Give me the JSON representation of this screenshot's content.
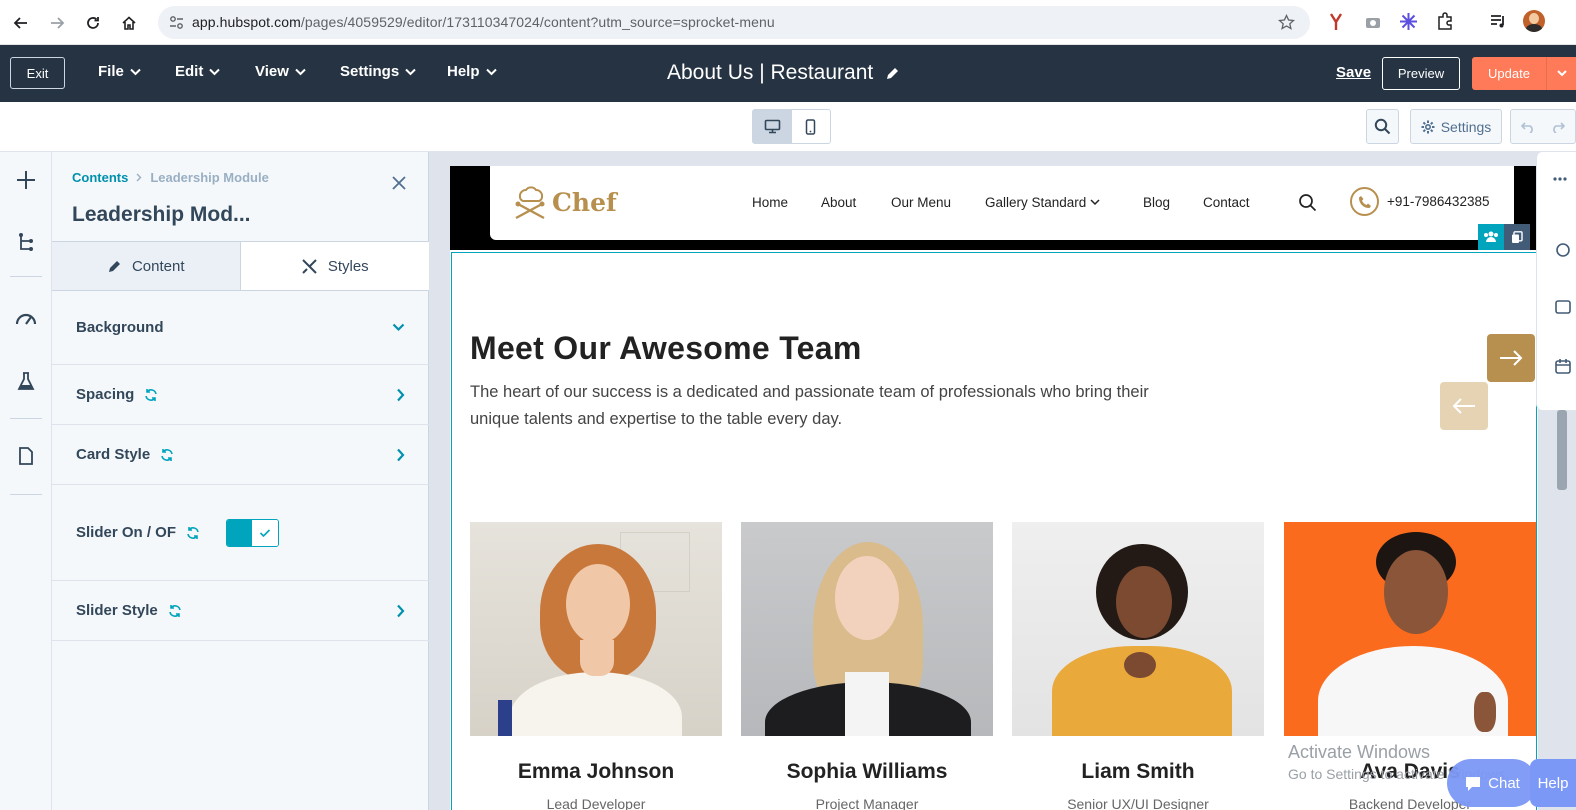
{
  "browser": {
    "url_host": "app.hubspot.com",
    "url_path": "/pages/4059529/editor/173110347024/content?utm_source=sprocket-menu"
  },
  "editor_bar": {
    "exit_label": "Exit",
    "menus": [
      "File",
      "Edit",
      "View",
      "Settings",
      "Help"
    ],
    "page_title": "About Us | Restaurant",
    "save_label": "Save",
    "preview_label": "Preview",
    "update_label": "Update"
  },
  "toolbar": {
    "settings_label": "Settings"
  },
  "panel": {
    "breadcrumb_root": "Contents",
    "breadcrumb_current": "Leadership Module",
    "title": "Leadership Mod...",
    "tabs": [
      "Content",
      "Styles"
    ],
    "sections": {
      "background": "Background",
      "spacing": "Spacing",
      "card_style": "Card Style",
      "slider_toggle": "Slider On / OF",
      "slider_style": "Slider Style"
    },
    "slider_enabled": true
  },
  "site": {
    "logo_text": "Chef",
    "nav": [
      "Home",
      "About",
      "Our Menu",
      "Gallery Standard",
      "Blog",
      "Contact"
    ],
    "phone": "+91-7986432385",
    "team_title": "Meet Our Awesome Team",
    "team_desc": "The heart of our success is a dedicated and passionate team of professionals who bring their unique talents and expertise to the table every day.",
    "members": [
      {
        "name": "Emma Johnson",
        "role": "Lead Developer"
      },
      {
        "name": "Sophia Williams",
        "role": "Project Manager"
      },
      {
        "name": "Liam Smith",
        "role": "Senior UX/UI Designer"
      },
      {
        "name": "Ava Davis",
        "role": "Backend Developer"
      }
    ]
  },
  "overlay": {
    "watermark_title": "Activate Windows",
    "watermark_sub": "Go to Settings to activate Windows.",
    "chat_label": "Chat",
    "help_label": "Help"
  },
  "colors": {
    "editor_dark": "#253342",
    "accent_teal": "#00a4bd",
    "update_orange": "#ff7a59",
    "brand_gold": "#b7904f"
  }
}
